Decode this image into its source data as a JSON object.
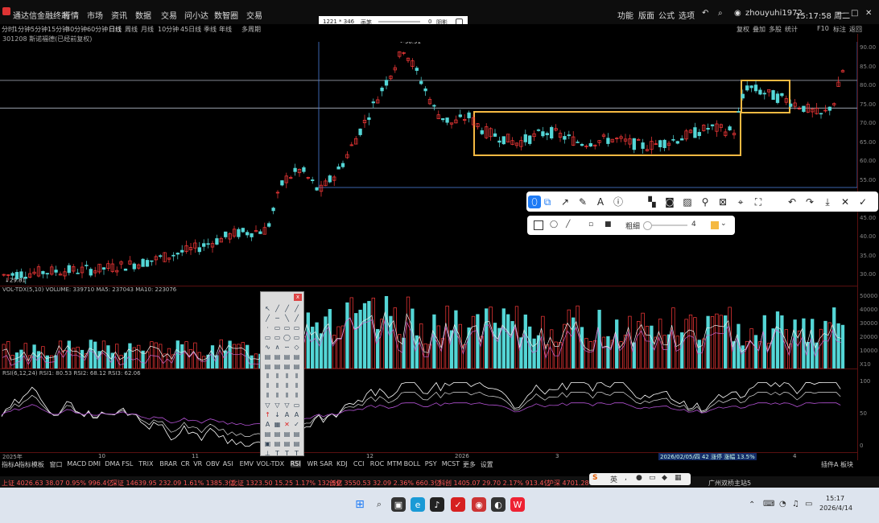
{
  "titlebar": {
    "app_name": "通达信金融终端",
    "menu": [
      "行情",
      "市场",
      "资讯",
      "数据",
      "交易",
      "问小达",
      "数智圈",
      "交易"
    ],
    "right_items": [
      "功能",
      "版面",
      "公式",
      "选项"
    ],
    "user": "zhouyuhi1972",
    "time": "15:17:58 周二"
  },
  "periodbar": {
    "items": [
      "分时",
      "1分钟",
      "5分钟",
      "15分钟",
      "30分钟",
      "60分钟",
      "日线",
      "周线",
      "月线",
      "10分钟",
      "45日线",
      "季线",
      "年线",
      "多周期"
    ],
    "right_items": [
      "复权",
      "叠加",
      "多股",
      "统计",
      "F10",
      "标注",
      "返回"
    ]
  },
  "stock": {
    "code_name": "301208 斯诺福德(已经前复权)",
    "high_label": "90.91",
    "low_label": "29.81"
  },
  "selection": {
    "size": "1221 * 346",
    "label": "画笔",
    "value": "0",
    "shadow_label": "阴影"
  },
  "price_axis": [
    "90.00",
    "85.00",
    "80.00",
    "75.00",
    "70.00",
    "65.00",
    "60.00",
    "55.00",
    "50.00",
    "45.00",
    "40.00",
    "35.00",
    "30.00"
  ],
  "volume_axis": [
    "50000",
    "40000",
    "30000",
    "20000",
    "10000",
    "X10"
  ],
  "rsi_axis": [
    "100",
    "50",
    "0"
  ],
  "volume_header": "VOL-TDX(5,10) VOLUME: 339710  MA5: 237043  MA10: 223076",
  "rsi_header": "RSI(6,12,24) RSI1: 80.53  RSI2: 68.12  RSI3: 62.06",
  "date_row": [
    "2025年",
    "10",
    "11",
    "12",
    "2026",
    "3",
    "4"
  ],
  "date_highlight": "2026/02/05/四  42  涨停  涨幅 13.5%",
  "indicator_tabs": [
    "指标A",
    "指标模板",
    "窗口",
    "MACD",
    "DMI",
    "DMA",
    "FSL",
    "TRIX",
    "BRAR",
    "CR",
    "VR",
    "OBV",
    "ASI",
    "EMV",
    "VOL-TDX",
    "RSI",
    "WR",
    "SAR",
    "KDJ",
    "CCI",
    "ROC",
    "MTM",
    "BOLL",
    "PSY",
    "MCST",
    "更多",
    "设置"
  ],
  "indicator_tabs_right": [
    "插件A",
    "板块"
  ],
  "status": {
    "sh": "上证 4026.63  38.07  0.95%  996.4亿",
    "sz": "深证 14639.95  232.09  1.61%  1385.3亿",
    "bj": "北证 1323.50  15.25  1.17%  132.5亿",
    "cy": "创业 3550.53  32.09  2.36%  660.3亿",
    "kc": "科创 1405.07  29.70  2.17%  913.4亿",
    "sz50": "沪深 4701.28",
    "right": "广州双桥主站5"
  },
  "ime": {
    "items": [
      "英",
      "拼"
    ]
  },
  "annotation": {
    "size_label": "粗细",
    "size_value": "4",
    "color": "#f5b942"
  },
  "taskbar": {
    "time": "15:17",
    "date": "2026/4/14"
  },
  "colors": {
    "up": "#ff3b3b",
    "down": "#54d6d6",
    "box": "#f5b942",
    "bg": "#000000"
  }
}
